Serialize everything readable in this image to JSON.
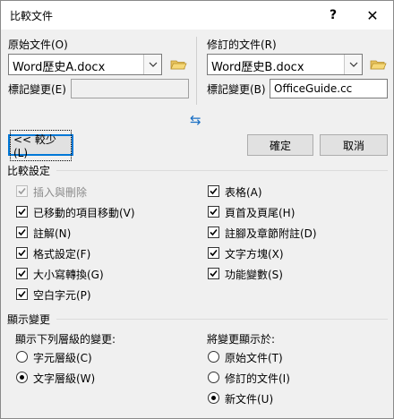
{
  "dialog": {
    "title": "比較文件",
    "help": "?",
    "close": "✕"
  },
  "original": {
    "label": "原始文件(O)",
    "file": "Word歷史A.docx",
    "label_changes": "標記變更(E)",
    "label_changes_value": ""
  },
  "revised": {
    "label": "修訂的文件(R)",
    "file": "Word歷史B.docx",
    "label_changes": "標記變更(B)",
    "label_changes_value": "OfficeGuide.cc"
  },
  "swap_icon": "⇆",
  "buttons": {
    "less": "<< 較少(L)",
    "ok": "確定",
    "cancel": "取消"
  },
  "comparison_settings": {
    "title": "比較設定",
    "left": [
      {
        "label": "插入與刪除",
        "checked": true,
        "disabled": true
      },
      {
        "label": "已移動的項目移動(V)",
        "checked": true,
        "disabled": false
      },
      {
        "label": "註解(N)",
        "checked": true,
        "disabled": false
      },
      {
        "label": "格式設定(F)",
        "checked": true,
        "disabled": false
      },
      {
        "label": "大小寫轉換(G)",
        "checked": true,
        "disabled": false
      },
      {
        "label": "空白字元(P)",
        "checked": true,
        "disabled": false
      }
    ],
    "right": [
      {
        "label": "表格(A)",
        "checked": true,
        "disabled": false
      },
      {
        "label": "頁首及頁尾(H)",
        "checked": true,
        "disabled": false
      },
      {
        "label": "註腳及章節附註(D)",
        "checked": true,
        "disabled": false
      },
      {
        "label": "文字方塊(X)",
        "checked": true,
        "disabled": false
      },
      {
        "label": "功能變數(S)",
        "checked": true,
        "disabled": false
      }
    ]
  },
  "show_changes": {
    "title": "顯示變更",
    "level_title": "顯示下列層級的變更:",
    "level_options": [
      {
        "label": "字元層級(C)",
        "selected": false
      },
      {
        "label": "文字層級(W)",
        "selected": true
      }
    ],
    "show_in_title": "將變更顯示於:",
    "show_in_options": [
      {
        "label": "原始文件(T)",
        "selected": false
      },
      {
        "label": "修訂的文件(I)",
        "selected": false
      },
      {
        "label": "新文件(U)",
        "selected": true
      }
    ]
  }
}
